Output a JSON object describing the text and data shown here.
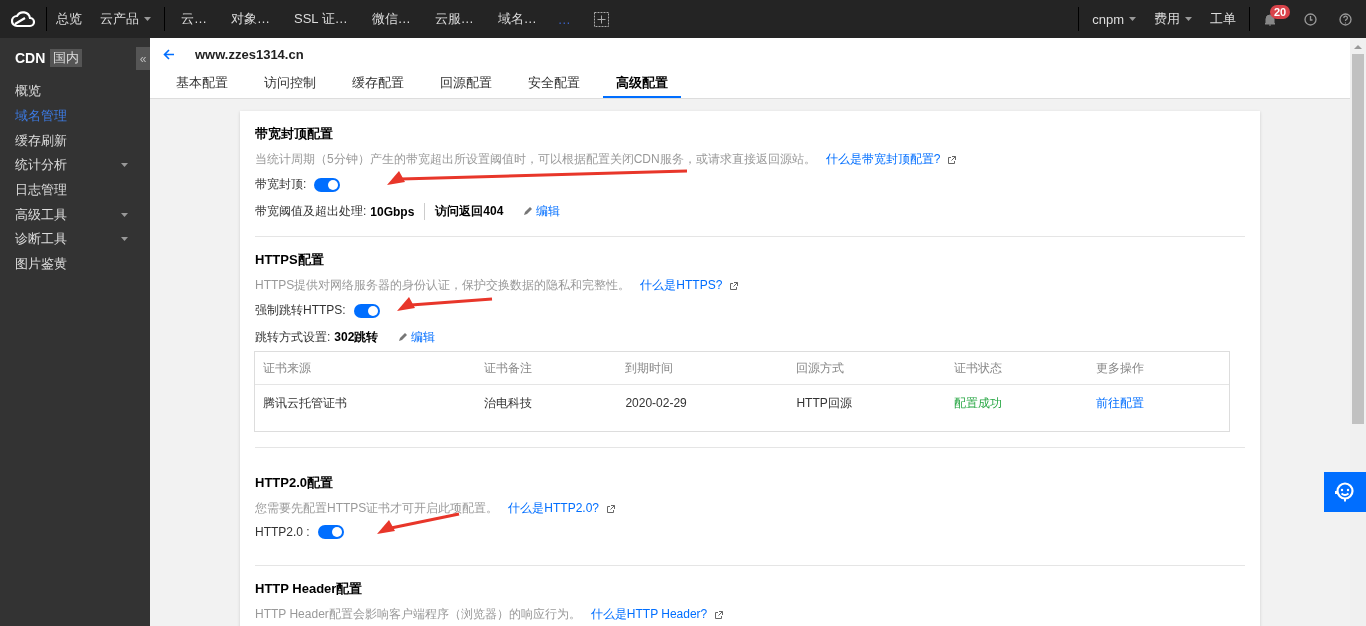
{
  "topbar": {
    "nav": [
      {
        "label": "总览",
        "dropdown": false
      },
      {
        "label": "云产品",
        "dropdown": true
      }
    ],
    "recent": [
      "云…",
      "对象…",
      "SSL 证…",
      "微信…",
      "云服…",
      "域名…"
    ],
    "more": "…",
    "right": [
      {
        "label": "cnpm",
        "dropdown": true
      },
      {
        "label": "费用",
        "dropdown": true
      },
      {
        "label": "工单",
        "dropdown": false
      }
    ],
    "notifications": "20"
  },
  "sidebar": {
    "title": "CDN",
    "tag": "国内",
    "collapse": "«",
    "items": [
      {
        "label": "概览",
        "selected": false,
        "submenu": false
      },
      {
        "label": "域名管理",
        "selected": true,
        "submenu": false
      },
      {
        "label": "缓存刷新",
        "selected": false,
        "submenu": false
      },
      {
        "label": "统计分析",
        "selected": false,
        "submenu": true
      },
      {
        "label": "日志管理",
        "selected": false,
        "submenu": false
      },
      {
        "label": "高级工具",
        "selected": false,
        "submenu": true
      },
      {
        "label": "诊断工具",
        "selected": false,
        "submenu": true
      },
      {
        "label": "图片鉴黄",
        "selected": false,
        "submenu": false
      }
    ]
  },
  "domain": "www.zzes1314.cn",
  "tabs": [
    {
      "label": "基本配置",
      "selected": false
    },
    {
      "label": "访问控制",
      "selected": false
    },
    {
      "label": "缓存配置",
      "selected": false
    },
    {
      "label": "回源配置",
      "selected": false
    },
    {
      "label": "安全配置",
      "selected": false
    },
    {
      "label": "高级配置",
      "selected": true
    }
  ],
  "sections": [
    {
      "title": "带宽封顶配置",
      "description": "当统计周期（5分钟）产生的带宽超出所设置阈值时，可以根据配置关闭CDN服务，或请求直接返回源站。",
      "link": "什么是带宽封顶配置?",
      "toggle": {
        "label": "带宽封顶:",
        "on": true
      },
      "detail": {
        "label": "带宽阈值及超出处理:",
        "values": [
          "10Gbps",
          "访问返回404"
        ],
        "edit": "编辑"
      }
    },
    {
      "title": "HTTPS配置",
      "description": "HTTPS提供对网络服务器的身份认证，保护交换数据的隐私和完整性。",
      "link": "什么是HTTPS?",
      "toggle": {
        "label": "强制跳转HTTPS:",
        "on": true
      },
      "detail": {
        "label": "跳转方式设置:",
        "values": [
          "302跳转"
        ],
        "edit": "编辑"
      },
      "table": {
        "columns": [
          "证书来源",
          "证书备注",
          "到期时间",
          "回源方式",
          "证书状态",
          "更多操作"
        ],
        "rows": [
          {
            "source": "腾讯云托管证书",
            "note": "治电科技",
            "expires": "2020-02-29",
            "origin": "HTTP回源",
            "status": "配置成功",
            "action": "前往配置"
          }
        ]
      }
    },
    {
      "title": "HTTP2.0配置",
      "description": "您需要先配置HTTPS证书才可开启此项配置。",
      "link": "什么是HTTP2.0?",
      "toggle": {
        "label": "HTTP2.0 :",
        "on": true
      }
    },
    {
      "title": "HTTP Header配置",
      "description": "HTTP Header配置会影响客户端程序（浏览器）的响应行为。",
      "link": "什么是HTTP Header?"
    }
  ]
}
